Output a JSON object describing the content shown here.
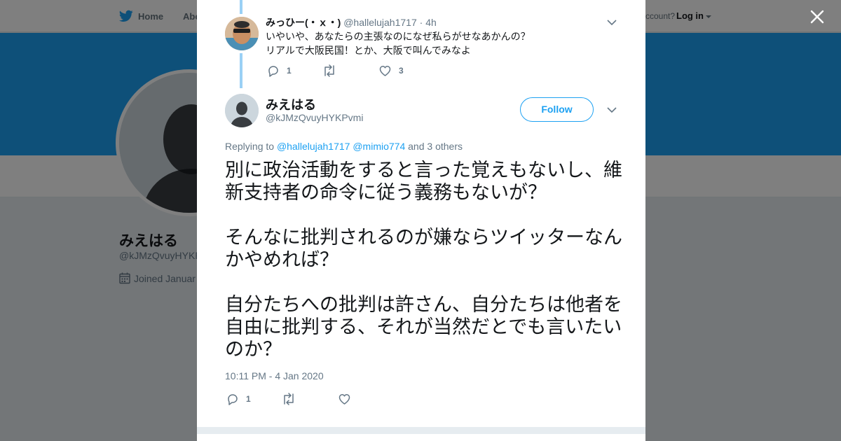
{
  "nav": {
    "home_label": "Home",
    "about_label": "Abo",
    "account_prompt": "ccount?",
    "login_label": "Log in"
  },
  "profile": {
    "name": "みえはる",
    "handle": "@kJMzQvuyHYKP",
    "joined": "Joined Januar"
  },
  "parent_tweet": {
    "name": "みっひー(・ｘ・)",
    "handle": "@hallelujah1717",
    "separator": "·",
    "time": "4h",
    "text_lines": [
      "いやいや、あなたらの主張なのになぜ私らがせなあかんの？",
      "リアルで大阪民国！とか、大阪で叫んでみなよ"
    ],
    "reply_count": "1",
    "retweet_count": "",
    "like_count": "3"
  },
  "main_tweet": {
    "name": "みえはる",
    "handle": "@kJMzQvuyHYKPvmi",
    "follow_label": "Follow",
    "replying_prefix": "Replying to",
    "replying_user1": "@hallelujah1717",
    "replying_user2": "@mimio774",
    "replying_suffix": "and 3 others",
    "paragraphs": [
      "別に政治活動をすると言った覚えもないし、維新支持者の命令に従う義務もないが？",
      "そんなに批判されるのが嫌ならツイッターなんかやめれば？",
      "自分たちへの批判は許さん、自分たちは他者を自由に批判する、それが当然だとでも言いたいのか？"
    ],
    "timestamp": "10:11 PM - 4 Jan 2020",
    "reply_count": "1",
    "retweet_count": "",
    "like_count": ""
  },
  "colors": {
    "brand": "#1da1f2",
    "thread_line": "#9ad0f5",
    "muted": "#657786"
  },
  "icons": [
    "twitter-bird-icon",
    "calendar-icon",
    "close-icon",
    "chevron-down-icon",
    "reply-icon",
    "retweet-icon",
    "heart-icon"
  ]
}
